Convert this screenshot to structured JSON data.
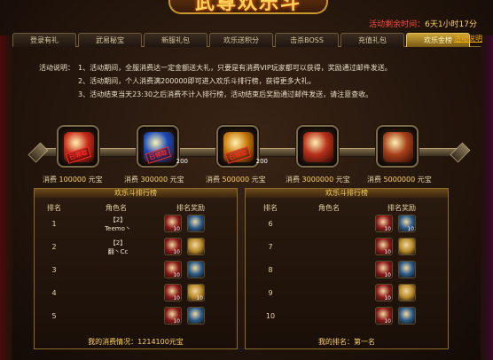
{
  "title": "武尊欢乐斗",
  "countdown": {
    "label": "活动剩余时间：",
    "value": "6天1小时17分"
  },
  "tabs": [
    "登录有礼",
    "武易秘宝",
    "新服礼包",
    "欢乐送积分",
    "击杀BOSS",
    "充值礼包",
    "欢乐金榜"
  ],
  "active_tab": 6,
  "detail_link": "活动说明",
  "rules": {
    "lead": "活动说明：",
    "lines": [
      "1、活动期间，全服消费达一定金额送大礼，只要是有消费VIP玩家都可以获得，奖励通过邮件发送。",
      "2、活动期间，个人消费满200000即可进入欢乐斗排行榜，获得更多大礼。",
      "3、活动结束当天23:30之后消费不计入排行榜，活动结束后奖励通过邮件发送，请注意查收。"
    ]
  },
  "tiers": [
    {
      "prefix": "消费",
      "amount": "100000",
      "unit": "元宝",
      "color": "#c82a1a",
      "icon": "gift-box-icon",
      "stamp": "已领取",
      "count": ""
    },
    {
      "prefix": "消费",
      "amount": "300000",
      "unit": "元宝",
      "color": "#1a4ab8",
      "icon": "lantern-icon",
      "stamp": "已领取",
      "count": "200"
    },
    {
      "prefix": "消费",
      "amount": "500000",
      "unit": "元宝",
      "color": "#c8780a",
      "icon": "moon-icon",
      "stamp": "已领取",
      "count": "200"
    },
    {
      "prefix": "消费",
      "amount": "3000000",
      "unit": "元宝",
      "color": "#b8301a",
      "icon": "treasure-chest-icon",
      "stamp": "",
      "count": ""
    },
    {
      "prefix": "消费",
      "amount": "5000000",
      "unit": "元宝",
      "color": "#a8401a",
      "icon": "treasure-chest-icon",
      "stamp": "",
      "count": ""
    }
  ],
  "left_panel": {
    "title": "欢乐斗排行榜",
    "headers": {
      "rank": "排名",
      "name": "角色名",
      "reward": "排名奖励"
    },
    "rows": [
      {
        "rank": "1",
        "name_line1": "【2】",
        "name_line2": "Teemo丶",
        "q1": "10",
        "q2": ""
      },
      {
        "rank": "2",
        "name_line1": "【2】",
        "name_line2": "翻丶Cc",
        "q1": "10",
        "q2": ""
      },
      {
        "rank": "3",
        "name_line1": "",
        "name_line2": "",
        "q1": "10",
        "q2": ""
      },
      {
        "rank": "4",
        "name_line1": "",
        "name_line2": "",
        "q1": "10",
        "q2": "10"
      },
      {
        "rank": "5",
        "name_line1": "",
        "name_line2": "",
        "q1": "10",
        "q2": ""
      }
    ],
    "footer": "我的消费情况：1214100元宝"
  },
  "right_panel": {
    "title": "欢乐斗排行榜",
    "headers": {
      "rank": "排名",
      "name": "角色名",
      "reward": "排名奖励"
    },
    "rows": [
      {
        "rank": "6",
        "q1": "10",
        "q2": "10"
      },
      {
        "rank": "7",
        "q1": "10",
        "q2": ""
      },
      {
        "rank": "8",
        "q1": "10",
        "q2": ""
      },
      {
        "rank": "9",
        "q1": "10",
        "q2": ""
      },
      {
        "rank": "10",
        "q1": "10",
        "q2": ""
      }
    ],
    "footer": "我的排名：第一名"
  }
}
